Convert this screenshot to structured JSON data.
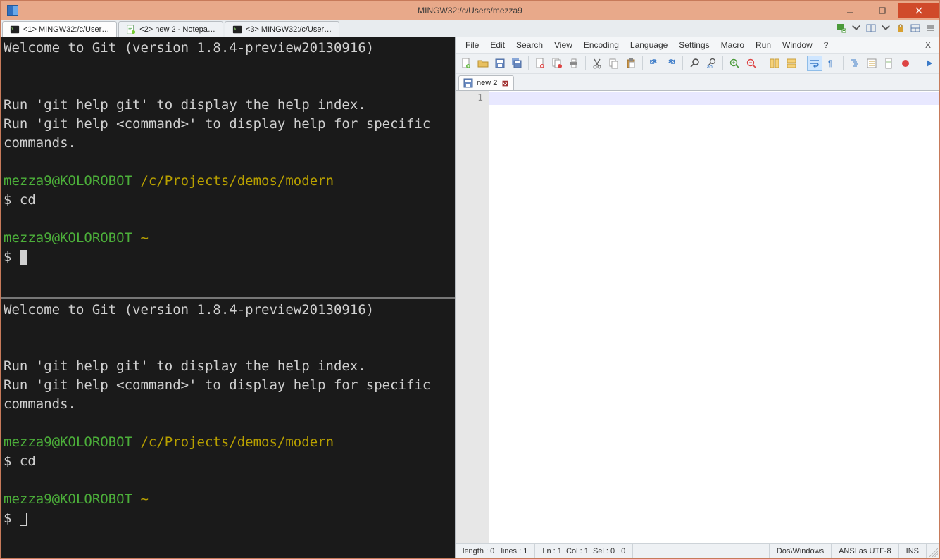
{
  "window": {
    "title": "MINGW32:/c/Users/mezza9"
  },
  "tabs": [
    {
      "label": "<1> MINGW32:/c/User…"
    },
    {
      "label": "<2> new  2 - Notepa…"
    },
    {
      "label": "<3> MINGW32:/c/User…"
    }
  ],
  "terminal": {
    "welcome": "Welcome to Git (version 1.8.4-preview20130916)",
    "blank": "",
    "help1": "Run 'git help git' to display the help index.",
    "help2": "Run 'git help <command>' to display help for specific commands.",
    "prompt1_user": "mezza9@KOLOROBOT",
    "prompt1_path": " /c/Projects/demos/modern",
    "cmd1": "$ cd",
    "prompt2_user": "mezza9@KOLOROBOT",
    "prompt2_path": " ~",
    "cmd2": "$ "
  },
  "npp": {
    "menu": [
      "File",
      "Edit",
      "Search",
      "View",
      "Encoding",
      "Language",
      "Settings",
      "Macro",
      "Run",
      "Window",
      "?"
    ],
    "doctab": "new  2",
    "gutter_line": "1",
    "status": {
      "length": "length : 0",
      "lines": "lines : 1",
      "ln": "Ln : 1",
      "col": "Col : 1",
      "sel": "Sel : 0 | 0",
      "eol": "Dos\\Windows",
      "enc": "ANSI as UTF-8",
      "ins": "INS"
    }
  }
}
